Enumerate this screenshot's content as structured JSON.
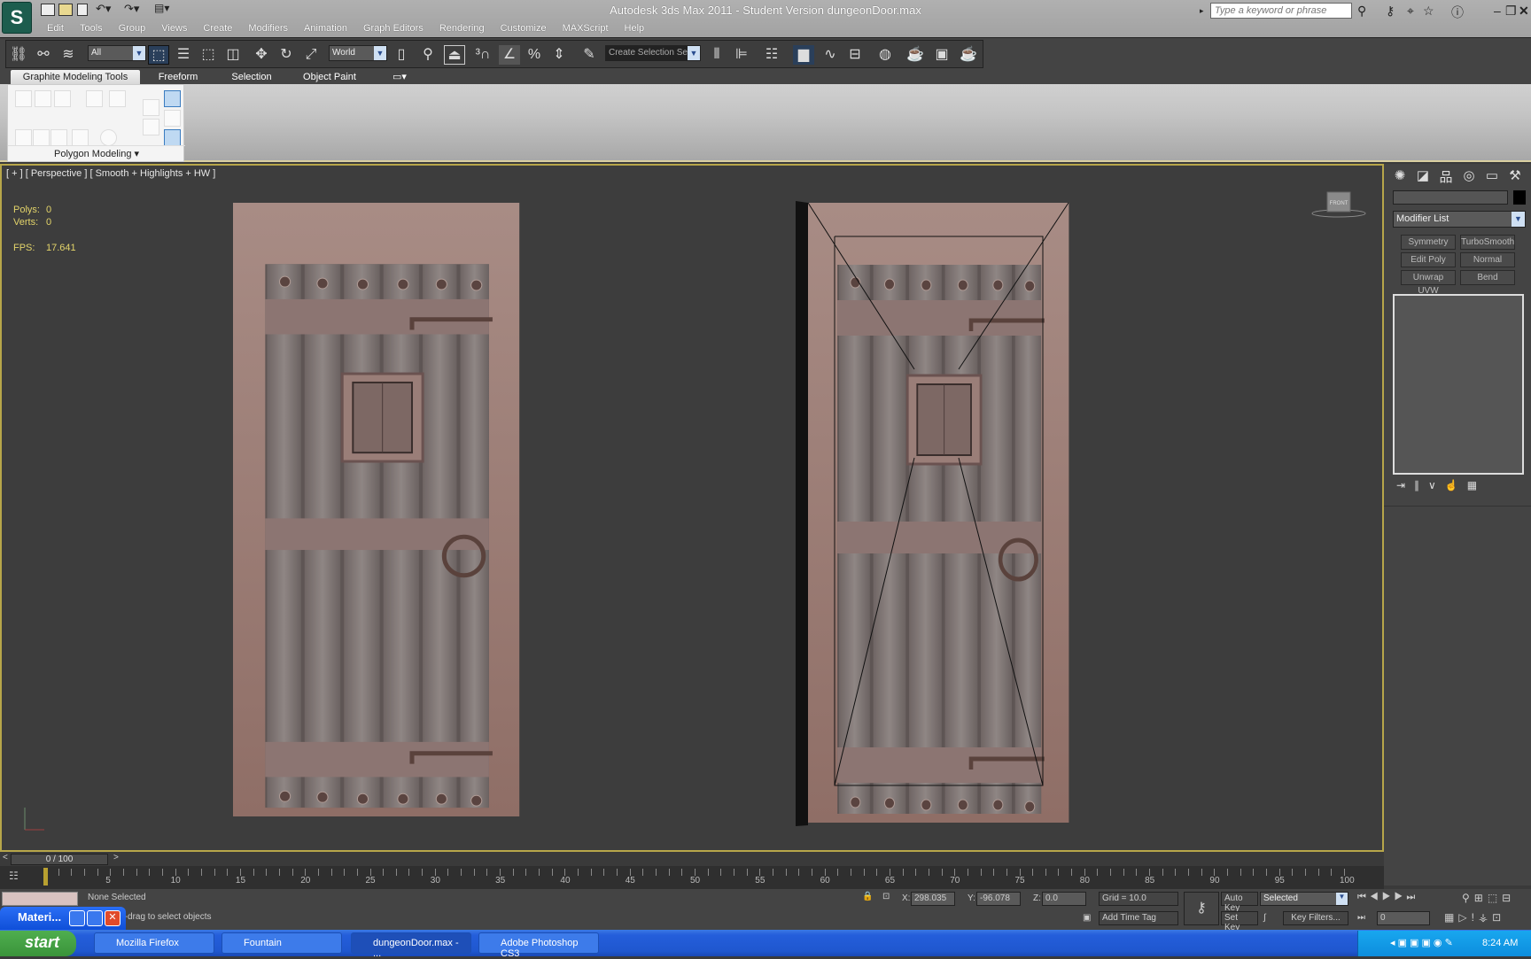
{
  "app": {
    "title": "Autodesk 3ds Max  2011  - Student Version    dungeonDoor.max",
    "logo_glyph": "S"
  },
  "menu": [
    "Edit",
    "Tools",
    "Group",
    "Views",
    "Create",
    "Modifiers",
    "Animation",
    "Graph Editors",
    "Rendering",
    "Customize",
    "MAXScript",
    "Help"
  ],
  "search": {
    "placeholder": "Type a keyword or phrase"
  },
  "toolbar": {
    "selection_filter": "All",
    "reference_coord": "World",
    "named_selection": "Create Selection Se"
  },
  "ribbon": {
    "tabs": [
      "Graphite Modeling Tools",
      "Freeform",
      "Selection",
      "Object Paint"
    ],
    "panel_label": "Polygon Modeling"
  },
  "viewport": {
    "label": "[ + ] [ Perspective ] [ Smooth + Highlights + HW ]",
    "stats": {
      "polys_label": "Polys:",
      "polys": "0",
      "verts_label": "Verts:",
      "verts": "0",
      "fps_label": "FPS:",
      "fps": "17.641"
    },
    "viewcube_label": "FRONT",
    "border_color": "#b7a64a"
  },
  "command_panel": {
    "modifier_list": "Modifier List",
    "buttons": [
      "Symmetry",
      "TurboSmooth",
      "Edit Poly",
      "Normal",
      "Unwrap UVW",
      "Bend"
    ]
  },
  "timeline": {
    "slider": "0 / 100",
    "current_frame": 0,
    "ticks": [
      "0",
      "5",
      "10",
      "15",
      "20",
      "25",
      "30",
      "35",
      "40",
      "45",
      "50",
      "55",
      "60",
      "65",
      "70",
      "75",
      "80",
      "85",
      "90",
      "95",
      "100"
    ]
  },
  "status": {
    "selection": "None Selected",
    "prompt": "Click-and-drag to select objects",
    "x_label": "X:",
    "x": "298.035",
    "y_label": "Y:",
    "y": "-96.078",
    "z_label": "Z:",
    "z": "0.0",
    "grid": "Grid = 10.0",
    "add_time_tag": "Add Time Tag",
    "auto_key": "Auto Key",
    "set_key": "Set Key",
    "key_mode": "Selected",
    "key_filters": "Key Filters...",
    "frame": "0"
  },
  "material_window": {
    "label": "Materi..."
  },
  "taskbar": {
    "start": "start",
    "tasks": [
      "Mozilla Firefox",
      "Fountain",
      "dungeonDoor.max - ...",
      "Adobe Photoshop CS3"
    ],
    "clock": "8:24 AM"
  }
}
